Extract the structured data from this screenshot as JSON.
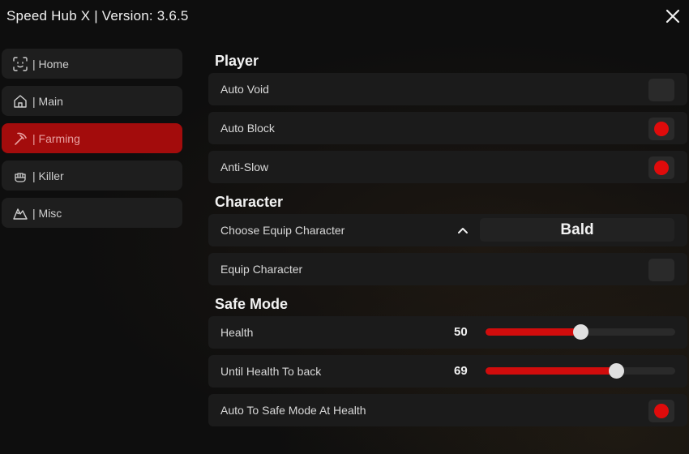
{
  "window": {
    "title": "Speed Hub X | Version: 3.6.5"
  },
  "sidebar": {
    "items": [
      {
        "label": "| Home",
        "icon": "face-scan-icon",
        "active": false
      },
      {
        "label": "| Main",
        "icon": "house-icon",
        "active": false
      },
      {
        "label": "| Farming",
        "icon": "pickaxe-icon",
        "active": true
      },
      {
        "label": "| Killer",
        "icon": "fist-icon",
        "active": false
      },
      {
        "label": "| Misc",
        "icon": "mountain-icon",
        "active": false
      }
    ]
  },
  "sections": {
    "player": {
      "title": "Player",
      "auto_void": {
        "label": "Auto Void",
        "enabled": false
      },
      "auto_block": {
        "label": "Auto Block",
        "enabled": true
      },
      "anti_slow": {
        "label": "Anti-Slow",
        "enabled": true
      }
    },
    "character": {
      "title": "Character",
      "choose_equip": {
        "label": "Choose Equip Character",
        "value": "Bald"
      },
      "equip_character": {
        "label": "Equip Character",
        "enabled": false
      }
    },
    "safe_mode": {
      "title": "Safe Mode",
      "health": {
        "label": "Health",
        "value": "50",
        "fraction": 0.5
      },
      "until_health": {
        "label": "Until Health To back",
        "value": "69",
        "fraction": 0.69
      },
      "auto_safe": {
        "label": "Auto To Safe Mode At Health",
        "enabled": true
      }
    }
  },
  "colors": {
    "accent": "#a30c0c",
    "toggle_on": "#e00b0b",
    "panel": "#1b1b1b"
  }
}
